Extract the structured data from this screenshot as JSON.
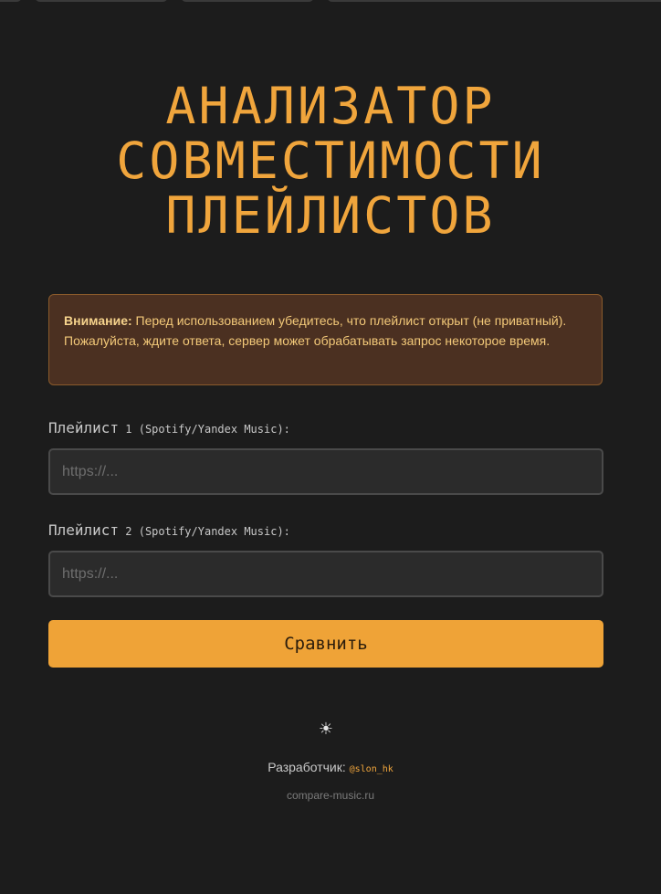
{
  "header": {
    "title_lines": [
      "АНАЛИЗАТОР",
      "СОВМЕСТИМОСТИ",
      "ПЛЕЙЛИСТОВ"
    ]
  },
  "warning": {
    "label": "Внимание:",
    "text": " Перед использованием убедитесь, что плейлист открыт (не приватный). Пожалуйста, ждите ответа, сервер может обрабатывать запрос некоторое время."
  },
  "form": {
    "playlist1": {
      "label_main": "Плейлист",
      "label_suffix": " 1 (Spotify/Yandex Music):",
      "placeholder": "https://...",
      "value": ""
    },
    "playlist2": {
      "label_main": "Плейлист",
      "label_suffix": " 2 (Spotify/Yandex Music):",
      "placeholder": "https://...",
      "value": ""
    },
    "submit_label": "Сравнить"
  },
  "footer": {
    "theme_icon": "sun-icon",
    "theme_glyph": "☀",
    "developer_label": "Разработчик: ",
    "developer_handle": "@slon_hk",
    "domain": "compare-music.ru"
  },
  "colors": {
    "background": "#1c1c1c",
    "accent": "#f0a53c",
    "warning_bg": "#4b3021"
  }
}
